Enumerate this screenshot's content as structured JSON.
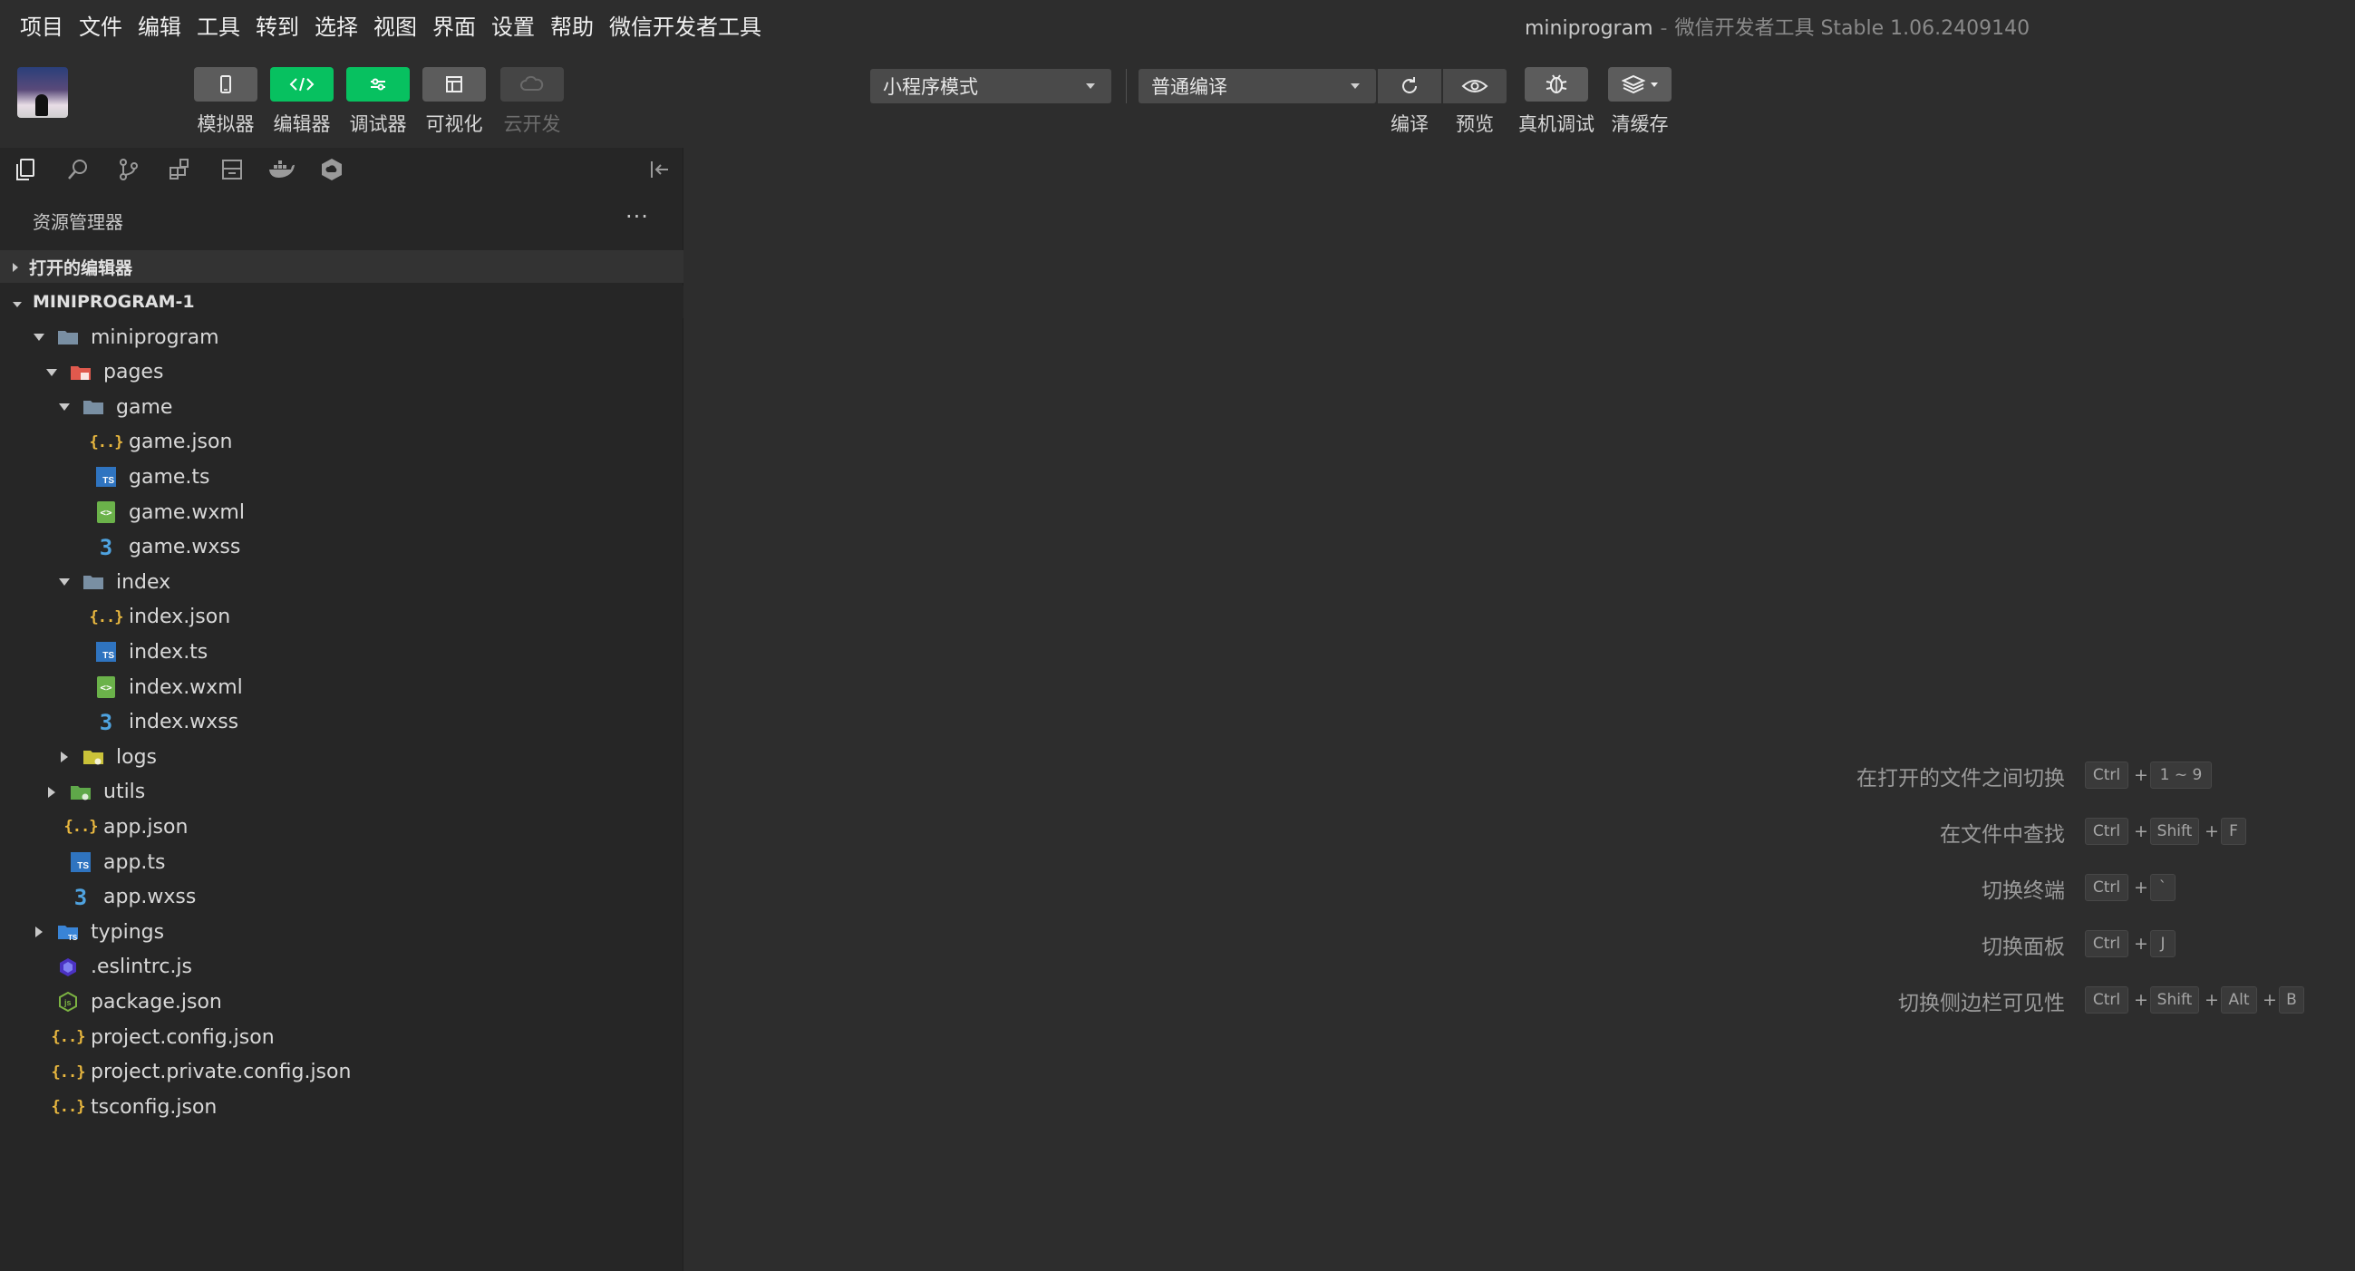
{
  "menubar": {
    "items": [
      "项目",
      "文件",
      "编辑",
      "工具",
      "转到",
      "选择",
      "视图",
      "界面",
      "设置",
      "帮助",
      "微信开发者工具"
    ]
  },
  "window": {
    "project": "miniprogram",
    "separator": "-",
    "app": "微信开发者工具 Stable 1.06.2409140"
  },
  "toolbar": {
    "simulator_label": "模拟器",
    "editor_label": "编辑器",
    "debugger_label": "调试器",
    "visual_label": "可视化",
    "cloud_label": "云开发",
    "mode_select": "小程序模式",
    "compile_select": "普通编译",
    "compile_label": "编译",
    "preview_label": "预览",
    "remote_debug_label": "真机调试",
    "clear_cache_label": "清缓存"
  },
  "sidebar": {
    "panel_title": "资源管理器",
    "more": "···",
    "open_editors": "打开的编辑器",
    "workspace": "MINIPROGRAM-1",
    "tree": [
      {
        "name": "miniprogram",
        "icon": "folder-open",
        "twisty": "open"
      },
      {
        "name": "pages",
        "icon": "folder-pages",
        "twisty": "open"
      },
      {
        "name": "game",
        "icon": "folder-open",
        "twisty": "open"
      },
      {
        "name": "game.json",
        "icon": "json"
      },
      {
        "name": "game.ts",
        "icon": "ts"
      },
      {
        "name": "game.wxml",
        "icon": "wxml"
      },
      {
        "name": "game.wxss",
        "icon": "wxss"
      },
      {
        "name": "index",
        "icon": "folder-open",
        "twisty": "open"
      },
      {
        "name": "index.json",
        "icon": "json"
      },
      {
        "name": "index.ts",
        "icon": "ts"
      },
      {
        "name": "index.wxml",
        "icon": "wxml"
      },
      {
        "name": "index.wxss",
        "icon": "wxss"
      },
      {
        "name": "logs",
        "icon": "folder-logs",
        "twisty": "closed"
      },
      {
        "name": "utils",
        "icon": "folder-utils",
        "twisty": "closed"
      },
      {
        "name": "app.json",
        "icon": "json"
      },
      {
        "name": "app.ts",
        "icon": "ts"
      },
      {
        "name": "app.wxss",
        "icon": "wxss"
      },
      {
        "name": "typings",
        "icon": "folder-typings",
        "twisty": "closed"
      },
      {
        "name": ".eslintrc.js",
        "icon": "eslint"
      },
      {
        "name": "package.json",
        "icon": "npm"
      },
      {
        "name": "project.config.json",
        "icon": "json"
      },
      {
        "name": "project.private.config.json",
        "icon": "json"
      },
      {
        "name": "tsconfig.json",
        "icon": "json"
      }
    ]
  },
  "shortcuts": [
    {
      "label": "在打开的文件之间切换",
      "keys": [
        "Ctrl",
        "1 ~ 9"
      ]
    },
    {
      "label": "在文件中查找",
      "keys": [
        "Ctrl",
        "Shift",
        "F"
      ]
    },
    {
      "label": "切换终端",
      "keys": [
        "Ctrl",
        "`"
      ]
    },
    {
      "label": "切换面板",
      "keys": [
        "Ctrl",
        "J"
      ]
    },
    {
      "label": "切换侧边栏可见性",
      "keys": [
        "Ctrl",
        "Shift",
        "Alt",
        "B"
      ]
    }
  ],
  "colors": {
    "accent_green": "#07c160",
    "background": "#2d2d2d",
    "sidebar": "#262626",
    "json_icon": "#e8b73f",
    "ts_icon": "#2f74c0",
    "wxml_icon": "#6bb24a",
    "wxss_icon": "#4fa3e0"
  }
}
